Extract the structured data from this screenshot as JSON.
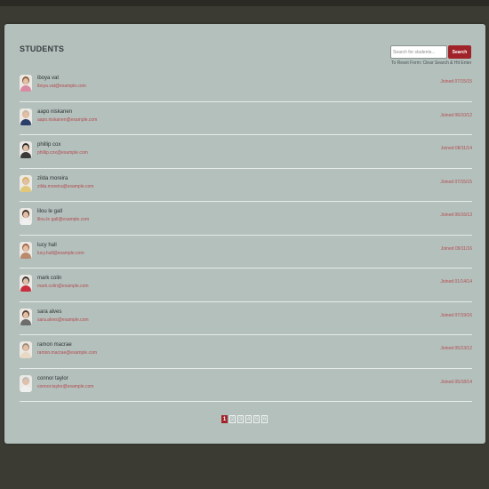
{
  "header": {
    "title": "STUDENTS",
    "search_placeholder": "Search for students...",
    "search_button": "Search",
    "reset_hint": "To Reset Form: Clear Search & Hit Enter"
  },
  "students": [
    {
      "name": "iboya vat",
      "email": "iboya.vat@example.com",
      "joined": "Joined 07/15/15"
    },
    {
      "name": "aapo niskanen",
      "email": "aapo.niskanen@example.com",
      "joined": "Joined 06/10/12"
    },
    {
      "name": "phillip cox",
      "email": "phillip.cox@example.com",
      "joined": "Joined 08/11/14"
    },
    {
      "name": "zilda moreira",
      "email": "zilda.moreira@example.com",
      "joined": "Joined 07/15/15"
    },
    {
      "name": "lilou le gall",
      "email": "lilou.le gall@example.com",
      "joined": "Joined 06/16/13"
    },
    {
      "name": "lucy hall",
      "email": "lucy.hall@example.com",
      "joined": "Joined 09/11/16"
    },
    {
      "name": "mark colin",
      "email": "mark.colin@example.com",
      "joined": "Joined 01/14/14"
    },
    {
      "name": "sara alves",
      "email": "sara.alves@example.com",
      "joined": "Joined 07/19/16"
    },
    {
      "name": "ramon macrae",
      "email": "ramon.macrae@example.com",
      "joined": "Joined 05/13/12"
    },
    {
      "name": "connor taylor",
      "email": "connor.taylor@example.com",
      "joined": "Joined 05/18/14"
    }
  ],
  "pagination": {
    "pages": [
      "1",
      "2",
      "3",
      "4",
      "5",
      "6"
    ],
    "current": "1"
  },
  "colors": {
    "accent": "#a1232a",
    "panel": "#b3c0bc",
    "background": "#3b3a33"
  },
  "icons": {
    "avatar": "student-avatar-icon"
  }
}
